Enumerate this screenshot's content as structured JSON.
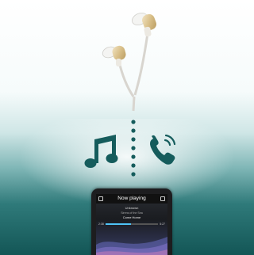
{
  "phone": {
    "header_title": "Now playing",
    "track_artist": "Unknown",
    "track_album": "Sirens of the Sea",
    "track_title": "Come Home",
    "elapsed": "2:38",
    "duration": "5:27",
    "progress_fraction": 0.48
  },
  "icons": [
    "music-note-icon",
    "phone-call-icon",
    "earphones"
  ],
  "colors": {
    "accent_teal": "#155c5c",
    "progress_blue": "#4fc3f7"
  }
}
